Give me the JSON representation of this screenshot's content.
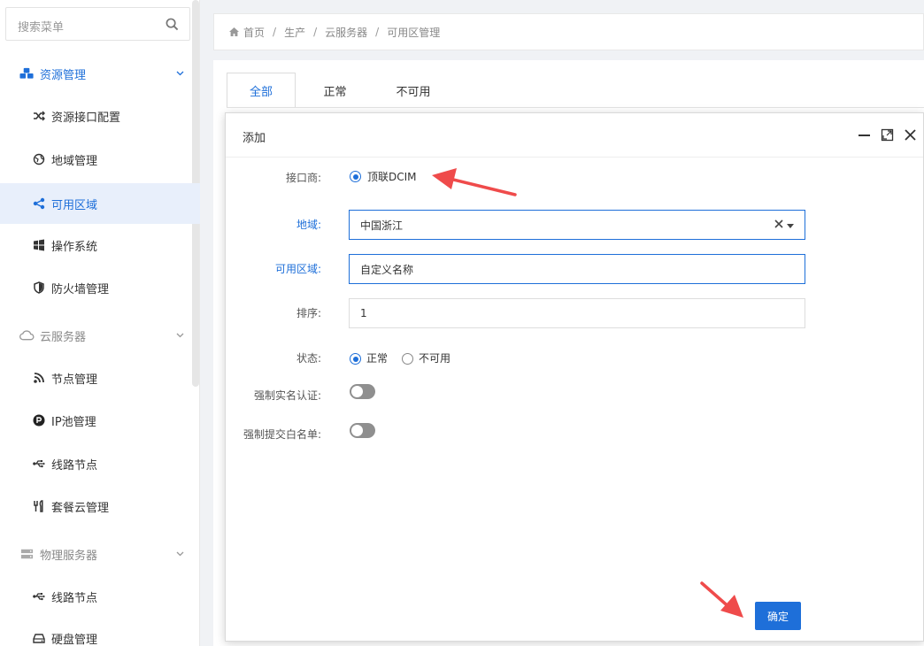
{
  "sidebar": {
    "search_placeholder": "搜索菜单",
    "groups": [
      {
        "label": "资源管理",
        "icon": "cubes-icon",
        "state": "active",
        "items": [
          {
            "label": "资源接口配置",
            "icon": "shuffle-icon"
          },
          {
            "label": "地域管理",
            "icon": "globe-icon"
          },
          {
            "label": "可用区域",
            "icon": "share-icon",
            "selected": true
          },
          {
            "label": "操作系统",
            "icon": "windows-icon"
          },
          {
            "label": "防火墙管理",
            "icon": "shield-icon"
          }
        ]
      },
      {
        "label": "云服务器",
        "icon": "cloud-icon",
        "state": "muted",
        "items": [
          {
            "label": "节点管理",
            "icon": "rss-icon"
          },
          {
            "label": "IP池管理",
            "icon": "product-hunt-icon"
          },
          {
            "label": "线路节点",
            "icon": "usb-icon"
          },
          {
            "label": "套餐云管理",
            "icon": "cutlery-icon"
          }
        ]
      },
      {
        "label": "物理服务器",
        "icon": "server-icon",
        "state": "muted",
        "items": [
          {
            "label": "线路节点",
            "icon": "usb-icon"
          },
          {
            "label": "硬盘管理",
            "icon": "hdd-icon"
          }
        ]
      }
    ]
  },
  "breadcrumb": [
    "首页",
    "生产",
    "云服务器",
    "可用区管理"
  ],
  "tabs": [
    {
      "label": "全部",
      "active": true
    },
    {
      "label": "正常"
    },
    {
      "label": "不可用"
    }
  ],
  "dialog": {
    "title": "添加",
    "fields": {
      "provider": {
        "label": "接口商:",
        "option": "顶联DCIM"
      },
      "region": {
        "label": "地域:",
        "value": "中国浙江"
      },
      "zone": {
        "label": "可用区域:",
        "placeholder": "自定义名称"
      },
      "sort": {
        "label": "排序:",
        "value": "1"
      },
      "status": {
        "label": "状态:",
        "options": [
          "正常",
          "不可用"
        ],
        "selected": "正常"
      },
      "force_realname": {
        "label": "强制实名认证:"
      },
      "force_whitelist": {
        "label": "强制提交白名单:"
      }
    },
    "confirm_label": "确定"
  },
  "colors": {
    "accent": "#1e6fd9",
    "annotation_arrow": "#ef4b4b"
  }
}
